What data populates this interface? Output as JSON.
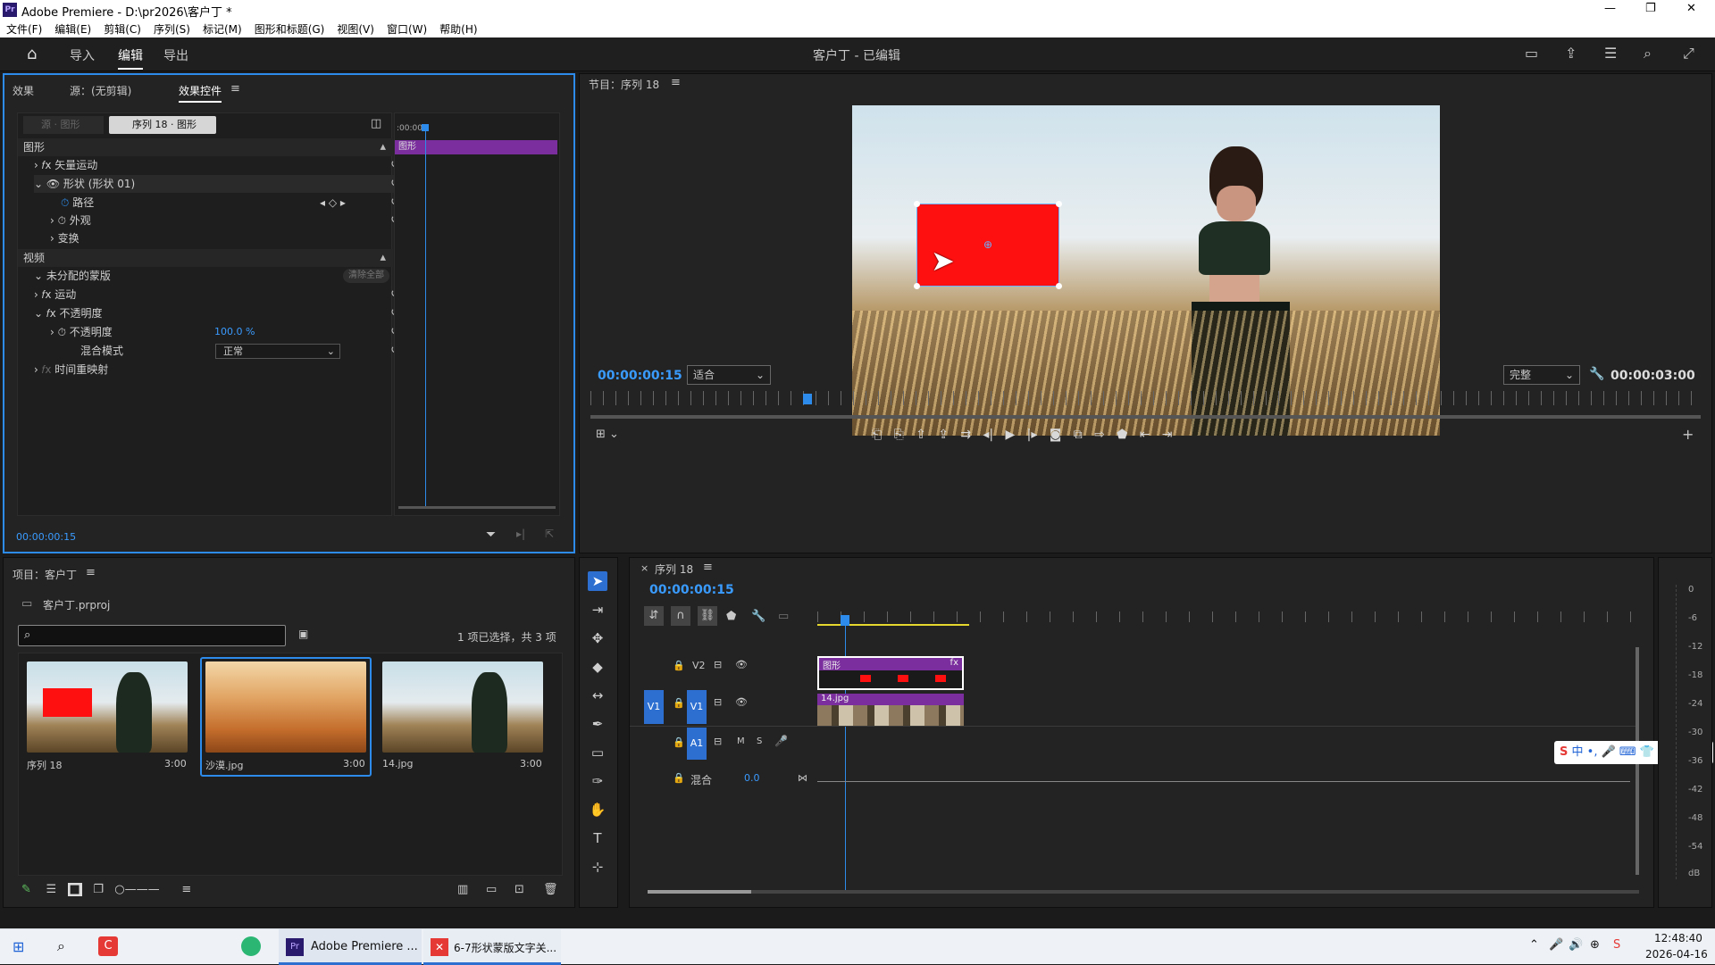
{
  "window": {
    "title": "Adobe Premiere - D:\\pr2026\\客户丁 *",
    "controls": [
      "—",
      "❐",
      "✕"
    ]
  },
  "menu": [
    "文件(F)",
    "编辑(E)",
    "剪辑(C)",
    "序列(S)",
    "标记(M)",
    "图形和标题(G)",
    "视图(V)",
    "窗口(W)",
    "帮助(H)"
  ],
  "app": {
    "tabs": [
      "导入",
      "编辑",
      "导出"
    ],
    "project_title": "客户丁 - 已编辑"
  },
  "effects_panel": {
    "tabs": [
      "效果",
      "源：(无剪辑)",
      "效果控件"
    ],
    "source_btn": "源 · 图形",
    "seq_btn": "序列 18 · 图形",
    "mini_time": ":00:00",
    "clip_label": "图形",
    "sections": {
      "graphic": "图形",
      "video": "视频"
    },
    "props": {
      "vector_motion": "矢量运动",
      "shape": "形状 (形状 01)",
      "path": "路径",
      "appearance": "外观",
      "transform": "变换",
      "mask": "未分配的蒙版",
      "clear_all": "清除全部",
      "motion": "运动",
      "opacity": "不透明度",
      "opacity_sub": "不透明度",
      "opacity_val": "100.0 %",
      "blend": "混合模式",
      "blend_val": "正常",
      "time_remap": "时间重映射"
    },
    "timecode": "00:00:00:15"
  },
  "program": {
    "title": "节目：序列 18",
    "timecode": "00:00:00:15",
    "fit": "适合",
    "quality": "完整",
    "duration": "00:00:03:00",
    "playhead_frac": 0.2
  },
  "project": {
    "title": "项目：客户丁",
    "file": "客户丁.prproj",
    "search_placeholder": "",
    "selection": "1 项已选择，共 3 项",
    "items": [
      {
        "name": "序列 18",
        "dur": "3:00"
      },
      {
        "name": "沙漠.jpg",
        "dur": "3:00"
      },
      {
        "name": "14.jpg",
        "dur": "3:00"
      }
    ]
  },
  "timeline": {
    "title": "序列 18",
    "timecode": "00:00:00:15",
    "tracks": {
      "v2": "V2",
      "v1": "V1",
      "v1_src": "V1",
      "a1": "A1",
      "a1_src": "A1",
      "m": "M",
      "s": "S",
      "mix": "混合",
      "mix_val": "0.0"
    },
    "clips": {
      "graphic": "图形",
      "fx": "fx",
      "img": "14.jpg"
    }
  },
  "meter_labels": [
    "0",
    "-6",
    "-12",
    "-18",
    "-24",
    "-30",
    "-36",
    "-42",
    "-48",
    "-54",
    "dB"
  ],
  "ime": {
    "text": "中 •, 🎤 ⌨ 👕 AI"
  },
  "taskbar": {
    "apps": [
      "Adobe Premiere ...",
      "6-7形状蒙版文字关..."
    ],
    "time": "12:48:40",
    "date": "2026-04-16"
  },
  "colors": {
    "accent": "#2d8ceb",
    "graphic_clip": "#7b2f9e",
    "shape": "#ff1010"
  }
}
